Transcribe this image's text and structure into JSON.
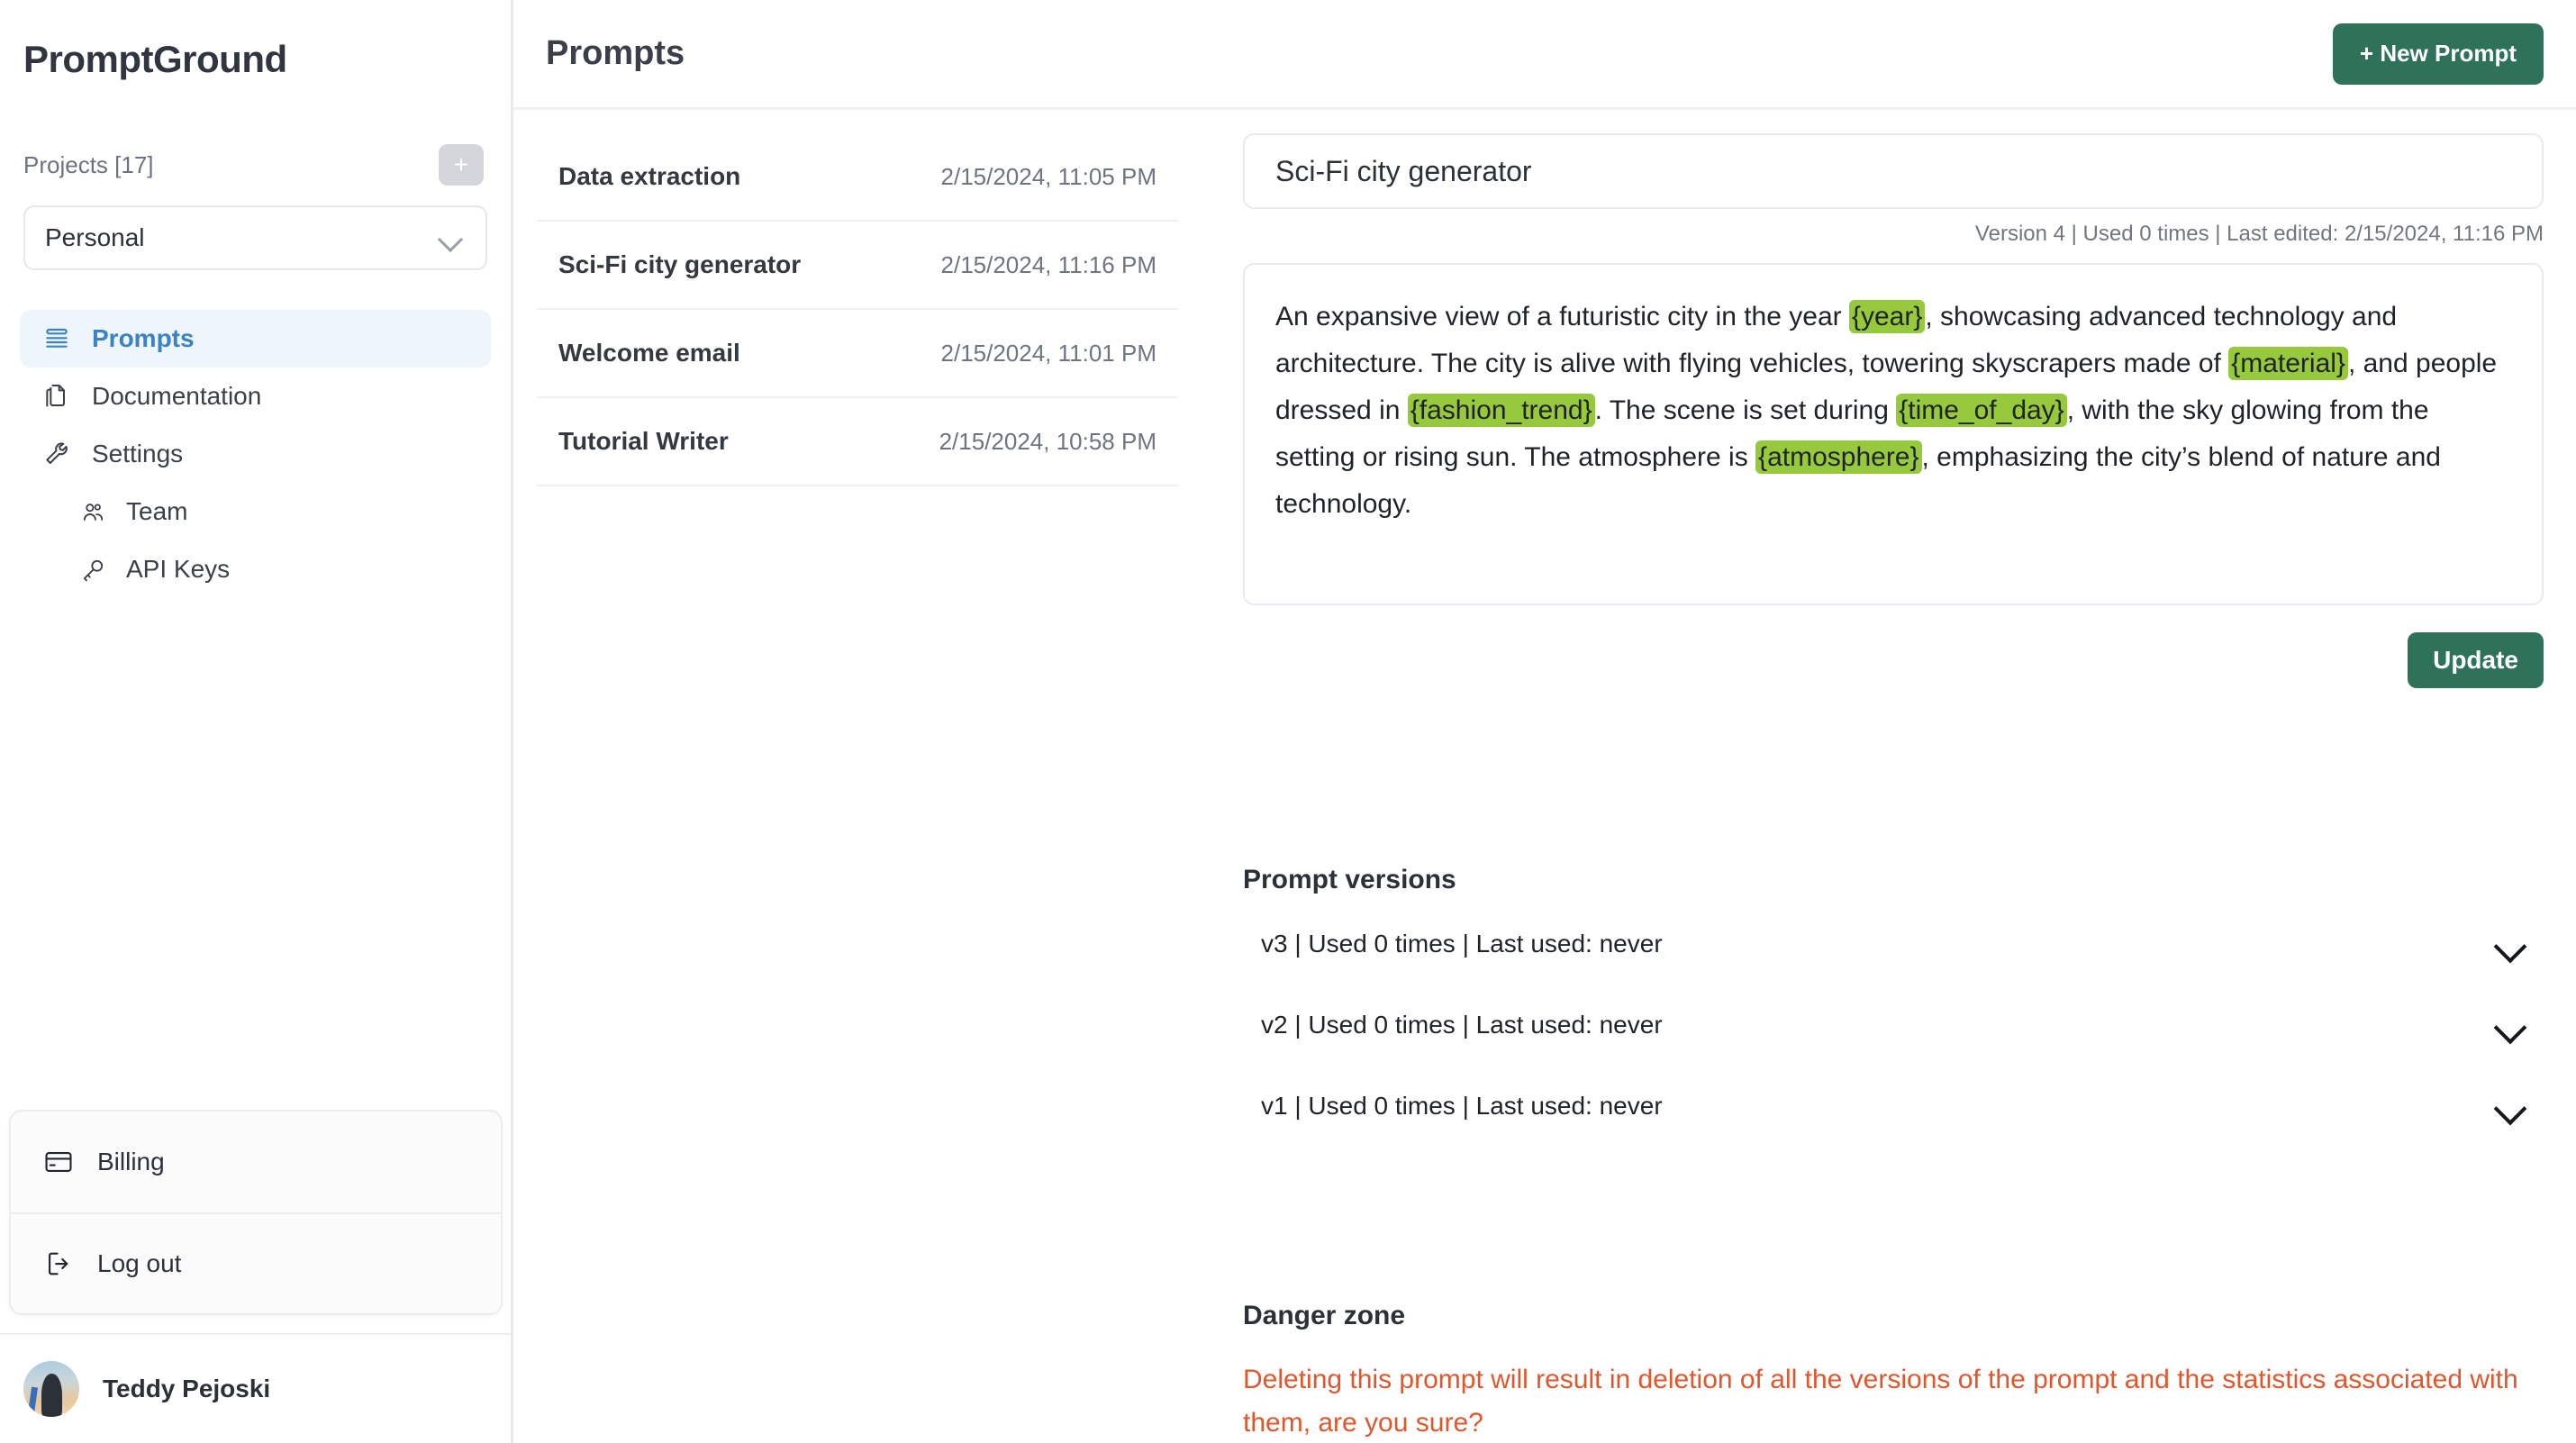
{
  "sidebar": {
    "brand": "PromptGround",
    "projects_label": "Projects [17]",
    "add_project_label": "+",
    "selected_project": "Personal",
    "nav": [
      {
        "label": "Prompts",
        "icon": "list-icon",
        "active": true
      },
      {
        "label": "Documentation",
        "icon": "documents-icon",
        "active": false
      },
      {
        "label": "Settings",
        "icon": "wrench-icon",
        "active": false
      },
      {
        "label": "Team",
        "icon": "users-icon",
        "active": false,
        "sub": true
      },
      {
        "label": "API Keys",
        "icon": "key-icon",
        "active": false,
        "sub": true
      }
    ],
    "account": [
      {
        "label": "Billing",
        "icon": "credit-card-icon"
      },
      {
        "label": "Log out",
        "icon": "logout-icon"
      }
    ],
    "user_name": "Teddy Pejoski"
  },
  "header": {
    "page_title": "Prompts",
    "new_prompt_label": "+ New Prompt"
  },
  "prompt_list": [
    {
      "name": "Data extraction",
      "date": "2/15/2024, 11:05 PM"
    },
    {
      "name": "Sci-Fi city generator",
      "date": "2/15/2024, 11:16 PM"
    },
    {
      "name": "Welcome email",
      "date": "2/15/2024, 11:01 PM"
    },
    {
      "name": "Tutorial Writer",
      "date": "2/15/2024, 10:58 PM"
    }
  ],
  "detail": {
    "title": "Sci-Fi city generator",
    "meta": "Version 4 | Used 0 times | Last edited: 2/15/2024, 11:16 PM",
    "prompt_segments": [
      {
        "text": "An expansive view of a futuristic city in the year ",
        "var": false
      },
      {
        "text": "{year}",
        "var": true
      },
      {
        "text": ", showcasing advanced technology and architecture. The city is alive with flying vehicles, towering skyscrapers made of ",
        "var": false
      },
      {
        "text": "{material}",
        "var": true
      },
      {
        "text": ", and people dressed in ",
        "var": false
      },
      {
        "text": "{fashion_trend}",
        "var": true
      },
      {
        "text": ". The scene is set during ",
        "var": false
      },
      {
        "text": "{time_of_day}",
        "var": true
      },
      {
        "text": ", with the sky glowing from the setting or rising sun. The atmosphere is ",
        "var": false
      },
      {
        "text": "{atmosphere}",
        "var": true
      },
      {
        "text": ", emphasizing the city’s blend of nature and technology.",
        "var": false
      }
    ],
    "update_label": "Update",
    "versions_title": "Prompt versions",
    "versions": [
      {
        "label": "v3 | Used 0 times | Last used: never"
      },
      {
        "label": "v2 | Used 0 times | Last used: never"
      },
      {
        "label": "v1 | Used 0 times | Last used: never"
      }
    ],
    "danger_title": "Danger zone",
    "danger_text": "Deleting this prompt will result in deletion of all the versions of the prompt and the statistics associated with them, are you sure?"
  },
  "colors": {
    "brand_green": "#2E7359",
    "accent_blue": "#3B82C4",
    "active_bg": "#EEF5FB",
    "highlight_green": "#97C93C",
    "danger_orange": "#E2562B"
  }
}
